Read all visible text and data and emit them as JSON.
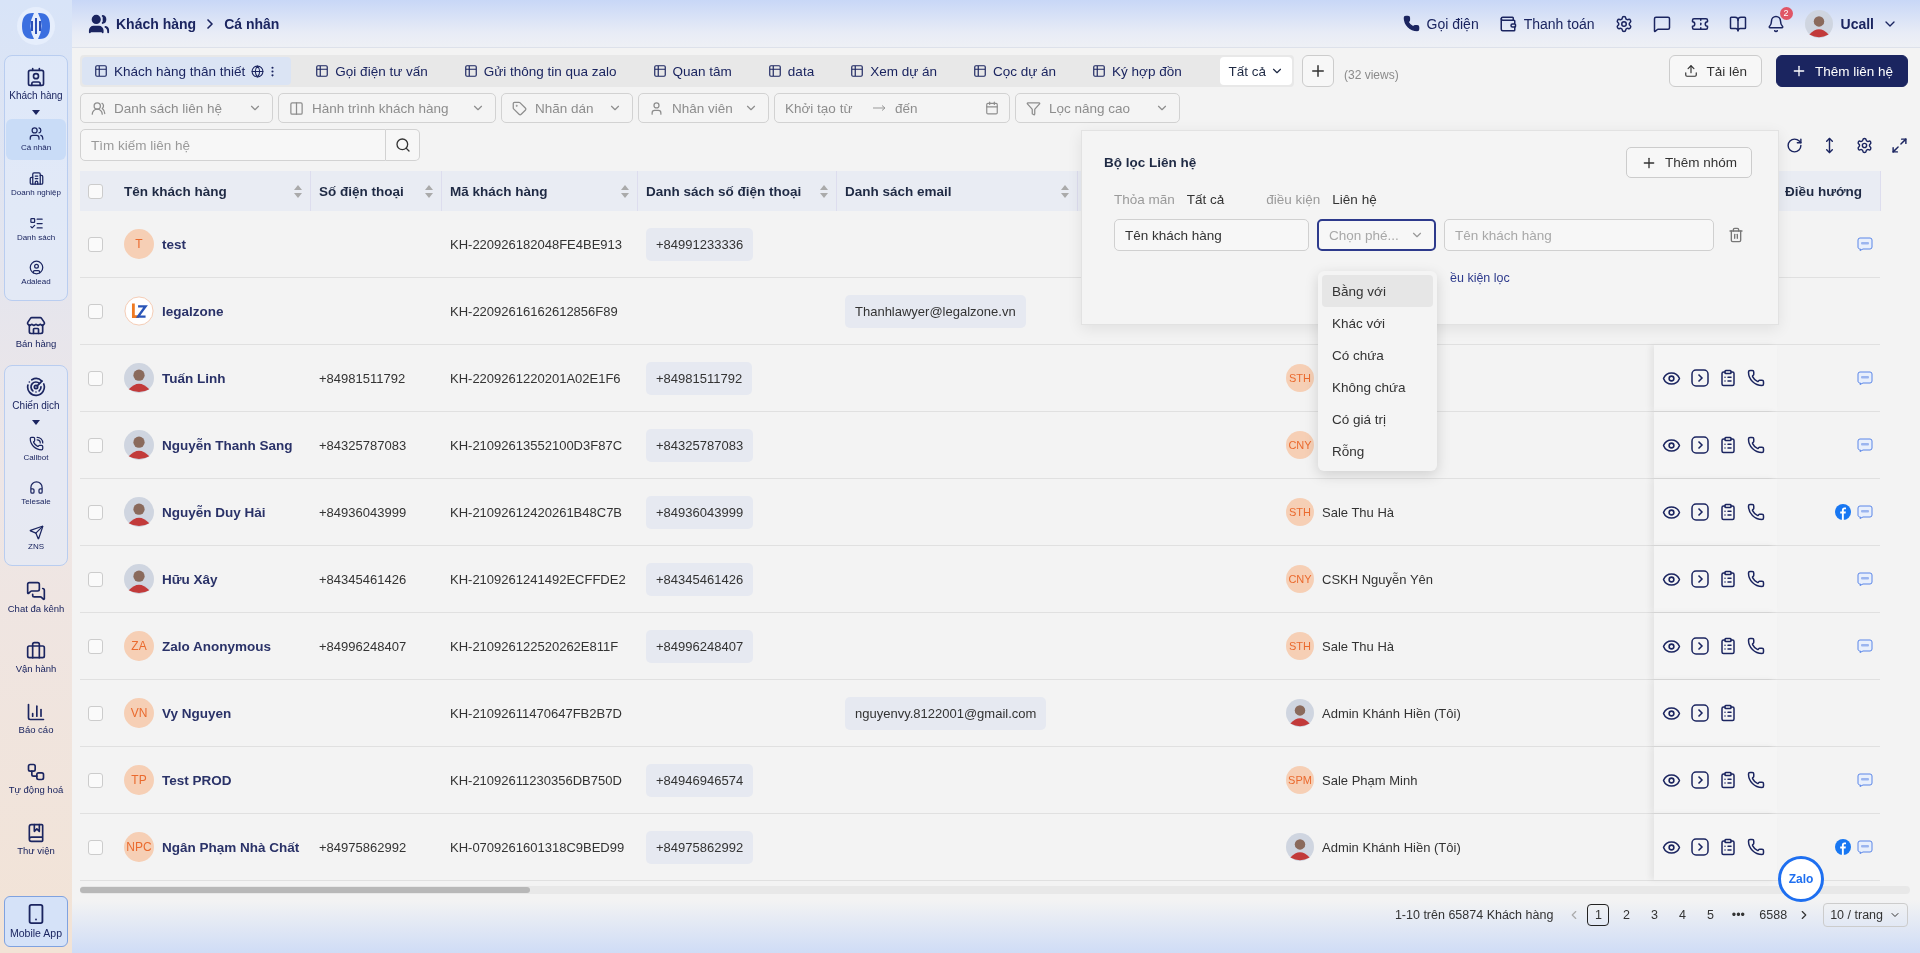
{
  "sidebar": {
    "items": [
      {
        "kind": "group",
        "label": "Khách hàng",
        "expanded": true,
        "children": [
          {
            "label": "Cá nhân",
            "selected": true
          },
          {
            "label": "Doanh nghiệp",
            "selected": false
          },
          {
            "label": "Danh sách",
            "selected": false
          },
          {
            "label": "Adalead",
            "selected": false
          }
        ]
      },
      {
        "kind": "item",
        "label": "Bán hàng"
      },
      {
        "kind": "group",
        "label": "Chiến dịch",
        "expanded": true,
        "children": [
          {
            "label": "Callbot",
            "selected": false
          },
          {
            "label": "Telesale",
            "selected": false
          },
          {
            "label": "ZNS",
            "selected": false
          }
        ]
      },
      {
        "kind": "item",
        "label": "Chat đa kênh"
      },
      {
        "kind": "item",
        "label": "Vận hành"
      },
      {
        "kind": "item",
        "label": "Báo cáo"
      },
      {
        "kind": "item",
        "label": "Tự động hoá"
      },
      {
        "kind": "item",
        "label": "Thư viện"
      },
      {
        "kind": "app",
        "label": "Mobile App"
      }
    ]
  },
  "header": {
    "breadcrumb": [
      "Khách hàng",
      "Cá nhân"
    ],
    "actions": [
      "Gọi điện",
      "Thanh toán"
    ],
    "notifications": "2",
    "user": "Ucall"
  },
  "views": {
    "tabs": [
      {
        "label": "Khách hàng thân thiết",
        "selected": true,
        "public": true
      },
      {
        "label": "Gọi điện tư vấn",
        "selected": false,
        "public": false
      },
      {
        "label": "Gửi thông tin qua zalo",
        "selected": false,
        "public": false
      },
      {
        "label": "Quan tâm",
        "selected": false,
        "public": false
      },
      {
        "label": "data",
        "selected": false,
        "public": false
      },
      {
        "label": "Xem dự án",
        "selected": false,
        "public": false
      },
      {
        "label": "Cọc dự án",
        "selected": false,
        "public": false
      },
      {
        "label": "Ký hợp đồn",
        "selected": false,
        "public": false
      }
    ],
    "all": "Tất cả",
    "count": "(32 views)"
  },
  "buttons": {
    "upload": "Tải lên",
    "add": "Thêm liên hệ"
  },
  "filters": [
    {
      "kind": "select",
      "placeholder": "Danh sách liên hệ"
    },
    {
      "kind": "select",
      "placeholder": "Hành trình khách hàng"
    },
    {
      "kind": "select",
      "placeholder": "Nhãn dán"
    },
    {
      "kind": "select",
      "placeholder": "Nhân viên"
    },
    {
      "kind": "range",
      "from": "Khởi tạo từ",
      "to": "đến"
    },
    {
      "kind": "select",
      "placeholder": "Lọc nâng cao"
    }
  ],
  "search": {
    "placeholder": "Tìm kiếm liên hệ"
  },
  "table": {
    "all_checked": false,
    "columns": [
      {
        "label": "Tên khách hàng",
        "sortable": true
      },
      {
        "label": "Số điện thoại",
        "sortable": true
      },
      {
        "label": "Mã khách hàng",
        "sortable": true
      },
      {
        "label": "Danh sách số điện thoại",
        "sortable": true
      },
      {
        "label": "Danh sách email",
        "sortable": true
      }
    ],
    "nav_column": {
      "label": "Điều hướng"
    },
    "rows": [
      {
        "checked": false,
        "avatar": {
          "kind": "initials",
          "text": "T"
        },
        "name": "test",
        "phone": "",
        "code": "KH-220926182048FE4BE913",
        "phones": "+84991233336",
        "email": "",
        "facebook": false,
        "zalo": true
      },
      {
        "checked": false,
        "avatar": {
          "kind": "logo"
        },
        "name": "legalzone",
        "phone": "",
        "code": "KH-22092616162612856F89",
        "phones": "",
        "email": "Thanhlawyer@legalzone.vn",
        "facebook": false,
        "zalo": false
      },
      {
        "checked": false,
        "avatar": {
          "kind": "photo"
        },
        "name": "Tuấn Linh",
        "phone": "+84981511792",
        "code": "KH-2209261220201A02E1F6",
        "phones": "+84981511792",
        "email": "",
        "staff": {
          "kind": "initials",
          "text": "STH"
        },
        "actions": {
          "call": true
        },
        "facebook": false,
        "zalo": true
      },
      {
        "checked": false,
        "avatar": {
          "kind": "photo"
        },
        "name": "Nguyễn Thanh Sang",
        "phone": "+84325787083",
        "code": "KH-21092613552100D3F87C",
        "phones": "+84325787083",
        "email": "",
        "staff": {
          "kind": "initials",
          "text": "CNY"
        },
        "actions": {
          "call": true
        },
        "facebook": false,
        "zalo": true
      },
      {
        "checked": false,
        "avatar": {
          "kind": "photo"
        },
        "name": "Nguyễn Duy Hải",
        "phone": "+84936043999",
        "code": "KH-21092612420261B48C7B",
        "phones": "+84936043999",
        "email": "",
        "staff": {
          "kind": "initials",
          "text": "STH",
          "name": "Sale Thu Hà"
        },
        "actions": {
          "call": true
        },
        "facebook": true,
        "zalo": true
      },
      {
        "checked": false,
        "avatar": {
          "kind": "photo"
        },
        "name": "Hữu Xây",
        "phone": "+84345461426",
        "code": "KH-2109261241492ECFFDE2",
        "phones": "+84345461426",
        "email": "",
        "staff": {
          "kind": "initials",
          "text": "CNY",
          "name": "CSKH Nguyễn Yên"
        },
        "actions": {
          "call": true
        },
        "facebook": false,
        "zalo": true
      },
      {
        "checked": false,
        "avatar": {
          "kind": "initials",
          "text": "ZA"
        },
        "name": "Zalo Anonymous",
        "phone": "+84996248407",
        "code": "KH-210926122520262E811F",
        "phones": "+84996248407",
        "email": "",
        "staff": {
          "kind": "initials",
          "text": "STH",
          "name": "Sale Thu Hà"
        },
        "actions": {
          "call": true
        },
        "facebook": false,
        "zalo": true
      },
      {
        "checked": false,
        "avatar": {
          "kind": "initials",
          "text": "VN"
        },
        "name": "Vy Nguyen",
        "phone": "",
        "code": "KH-21092611470647FB2B7D",
        "phones": "",
        "email": "nguyenvy.8122001@gmail.com",
        "staff": {
          "kind": "photo",
          "name": "Admin Khánh Hiền (Tôi)"
        },
        "actions": {
          "call": false
        },
        "facebook": false,
        "zalo": false
      },
      {
        "checked": false,
        "avatar": {
          "kind": "initials",
          "text": "TP"
        },
        "name": "Test PROD",
        "phone": "",
        "code": "KH-21092611230356DB750D",
        "phones": "+84946946574",
        "email": "",
        "staff": {
          "kind": "initials",
          "text": "SPM",
          "name": "Sale Phạm Minh"
        },
        "actions": {
          "call": true
        },
        "facebook": false,
        "zalo": true
      },
      {
        "checked": false,
        "avatar": {
          "kind": "initials",
          "text": "NPC"
        },
        "name": "Ngân Phạm Nhà Chất",
        "phone": "+84975862992",
        "code": "KH-0709261601318C9BED99",
        "phones": "+84975862992",
        "email": "",
        "staff": {
          "kind": "photo",
          "name": "Admin Khánh Hiền (Tôi)"
        },
        "actions": {
          "call": true
        },
        "facebook": true,
        "zalo": true
      }
    ]
  },
  "filter_panel": {
    "title": "Bộ lọc Liên hệ",
    "add_group": "Thêm nhóm",
    "match_label": "Thỏa mãn",
    "match_value": "Tất cả",
    "condition_label": "điều kiện",
    "condition_value": "Liên hệ",
    "field": "Tên khách hàng",
    "operator": {
      "placeholder": "Chọn phé...",
      "focused": true
    },
    "value": {
      "placeholder": "Tên khách hàng"
    },
    "add_condition": "ều kiện lọc",
    "options": [
      {
        "label": "Bằng với",
        "highlighted": true
      },
      {
        "label": "Khác với",
        "highlighted": false
      },
      {
        "label": "Có chứa",
        "highlighted": false
      },
      {
        "label": "Không chứa",
        "highlighted": false
      },
      {
        "label": "Có giá trị",
        "highlighted": false
      },
      {
        "label": "Rỗng",
        "highlighted": false
      }
    ]
  },
  "pagination": {
    "summary": "1-10 trên 65874 Khách hàng",
    "pages": [
      {
        "label": "1",
        "selected": true
      },
      {
        "label": "2",
        "selected": false
      },
      {
        "label": "3",
        "selected": false
      },
      {
        "label": "4",
        "selected": false
      },
      {
        "label": "5",
        "selected": false
      },
      {
        "label": "•••",
        "selected": false
      },
      {
        "label": "6588",
        "selected": false
      }
    ],
    "page_size": "10 / trang"
  },
  "zalo_button": "Zalo"
}
